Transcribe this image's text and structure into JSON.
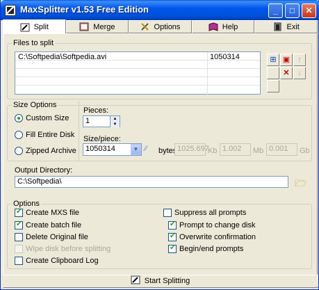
{
  "window": {
    "title": "MaxSplitter v1.53 Free Edition",
    "min": "_",
    "max": "□",
    "close": "✕"
  },
  "tabs": [
    {
      "label": "Split",
      "icon": "split-icon"
    },
    {
      "label": "Merge",
      "icon": "merge-icon"
    },
    {
      "label": "Options",
      "icon": "tools-icon"
    },
    {
      "label": "Help",
      "icon": "book-icon"
    },
    {
      "label": "Exit",
      "icon": "exit-icon"
    }
  ],
  "files": {
    "label": "Files to split",
    "rows": [
      {
        "path": "C:\\Softpedia\\Softpedia.avi",
        "size": "1050314"
      }
    ]
  },
  "size_options": {
    "label": "Size Options",
    "radios": [
      {
        "label": "Custom Size",
        "checked": true
      },
      {
        "label": "Fill Entire Disk",
        "checked": false
      },
      {
        "label": "Zipped Archive",
        "checked": false
      }
    ],
    "pieces_label": "Pieces:",
    "pieces_value": "1",
    "size_label": "Size/piece:",
    "size_value": "1050314",
    "bytes_label": "bytes",
    "kb_value": "1025.697",
    "kb_label": "Kb",
    "mb_value": "1.002",
    "mb_label": "Mb",
    "gb_value": "0.001",
    "gb_label": "Gb"
  },
  "output": {
    "label": "Output Directory:",
    "value": "C:\\Softpedia\\"
  },
  "options": {
    "label": "Options",
    "left": [
      {
        "label": "Create MXS file",
        "checked": true,
        "disabled": false
      },
      {
        "label": "Create batch file",
        "checked": true,
        "disabled": false
      },
      {
        "label": "Delete Original file",
        "checked": false,
        "disabled": false
      },
      {
        "label": "Wipe disk before splitting",
        "checked": false,
        "disabled": true
      },
      {
        "label": "Create Clipboard Log",
        "checked": false,
        "disabled": false
      }
    ],
    "suppress": {
      "label": "Suppress all prompts",
      "checked": false
    },
    "right": [
      {
        "label": "Prompt to change disk",
        "checked": true
      },
      {
        "label": "Overwrite confirmation",
        "checked": true
      },
      {
        "label": "Begin/end prompts",
        "checked": true
      }
    ]
  },
  "start_button": "Start Splitting"
}
